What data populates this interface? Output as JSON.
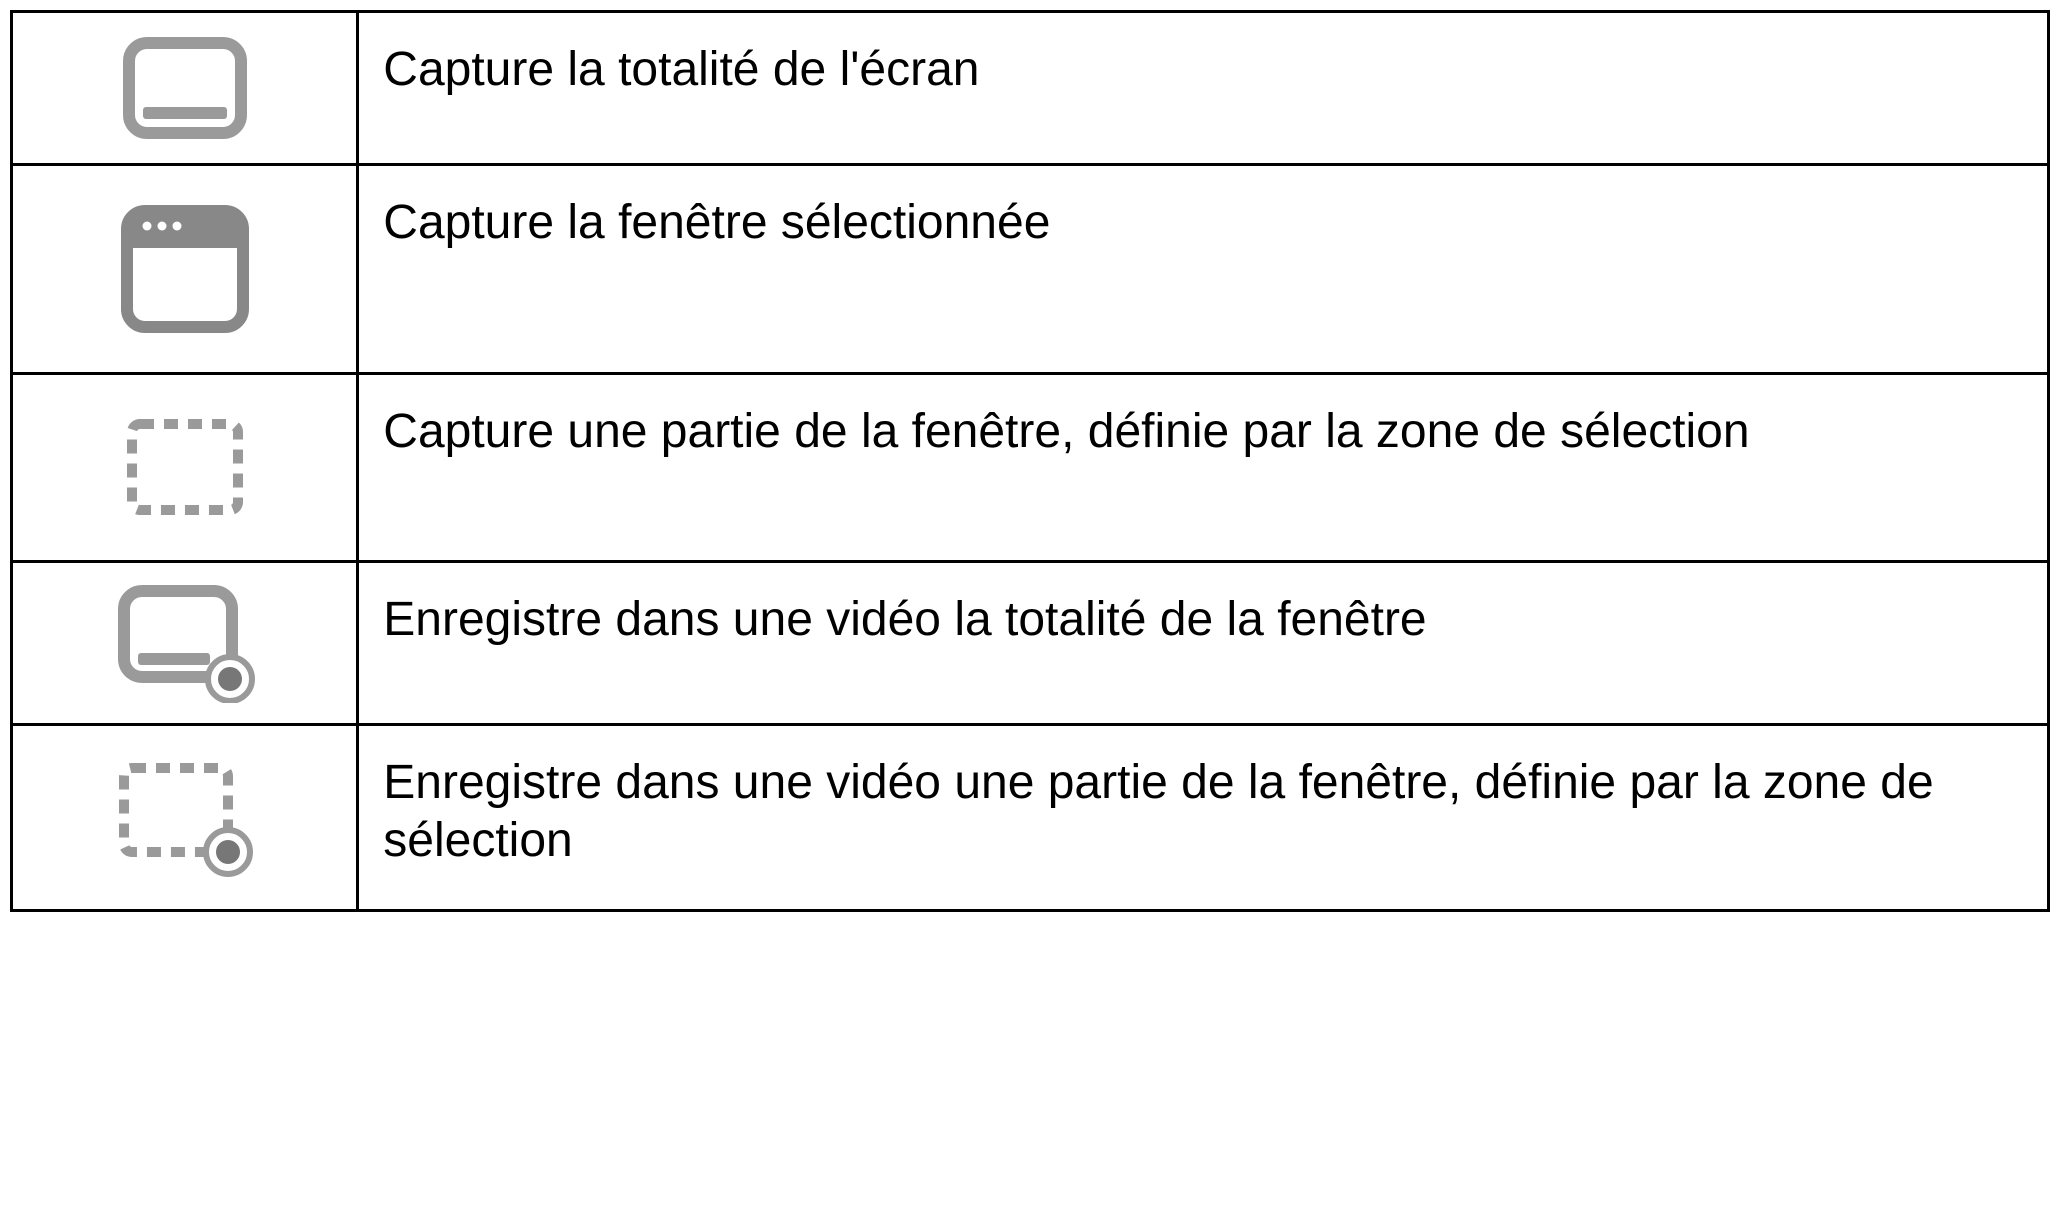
{
  "rows": [
    {
      "icon": "capture-full-screen-icon",
      "description": "Capture la totalité de l'écran"
    },
    {
      "icon": "capture-window-icon",
      "description": "Capture la fenêtre sélectionnée"
    },
    {
      "icon": "capture-selection-icon",
      "description": "Capture une partie de la fenêtre, définie par la zone de sélection"
    },
    {
      "icon": "record-full-window-icon",
      "description": "Enregistre dans une vidéo la totalité de la fenêtre"
    },
    {
      "icon": "record-selection-icon",
      "description": "Enregistre dans une vidéo une partie de la fenêtre, définie par la zone de sélection"
    }
  ]
}
